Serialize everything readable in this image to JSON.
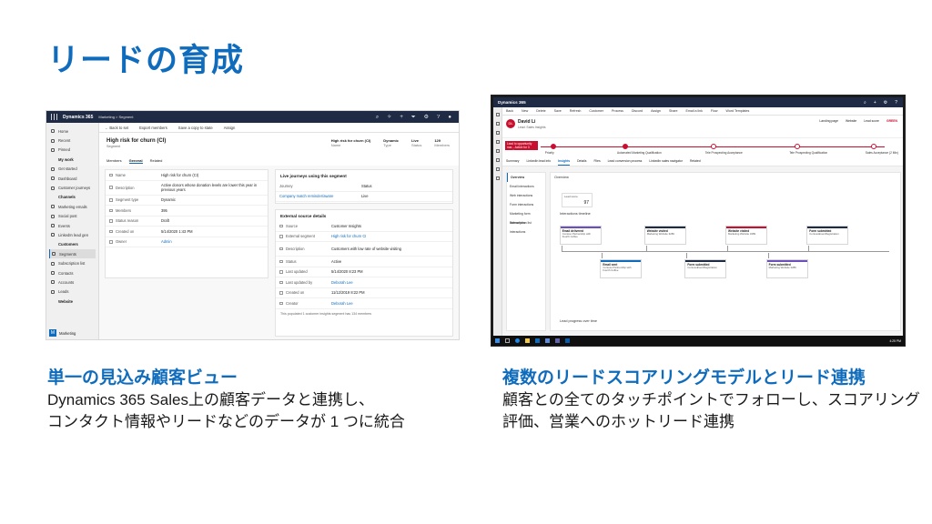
{
  "slide": {
    "title": "リードの育成"
  },
  "left": {
    "app_name": "Dynamics 365",
    "breadcrumb": "Marketing  >  Segment",
    "nav": [
      {
        "label": "Home",
        "group": false
      },
      {
        "label": "Recent",
        "group": false
      },
      {
        "label": "Pinned",
        "group": false
      },
      {
        "label": "My work",
        "group": true
      },
      {
        "label": "Get started",
        "group": false
      },
      {
        "label": "Dashboard",
        "group": false
      },
      {
        "label": "Customer journeys",
        "group": false
      },
      {
        "label": "Channels",
        "group": true
      },
      {
        "label": "Marketing emails",
        "group": false
      },
      {
        "label": "Social post",
        "group": false
      },
      {
        "label": "Events",
        "group": false
      },
      {
        "label": "LinkedIn lead gen",
        "group": false
      },
      {
        "label": "Customers",
        "group": true
      },
      {
        "label": "Segments",
        "group": false,
        "active": true
      },
      {
        "label": "Subscription list",
        "group": false
      },
      {
        "label": "Contacts",
        "group": false
      },
      {
        "label": "Accounts",
        "group": false
      },
      {
        "label": "Leads",
        "group": false
      },
      {
        "label": "Website",
        "group": true
      }
    ],
    "area_badge": "M",
    "area_label": "Marketing",
    "commands": [
      "← Back to set",
      "Export members",
      "Save a copy to state",
      "Assign"
    ],
    "record_title": "High risk for churn (CI)",
    "record_subtitle": "Segment",
    "tabs": [
      "Members",
      "General",
      "Related"
    ],
    "header_meta": [
      {
        "value": "High risk for churn (CI)",
        "label": "Name"
      },
      {
        "value": "Dynamic",
        "label": "Type"
      },
      {
        "value": "Live",
        "label": "Status"
      },
      {
        "value": "129",
        "label": "Members"
      }
    ],
    "general_fields": [
      {
        "label": "Name",
        "value": "High risk for churn (CI)"
      },
      {
        "label": "Description",
        "value": "Active donors whose donation levels are lower this year in previous years"
      },
      {
        "label": "Segment type",
        "value": "Dynamic"
      },
      {
        "label": "Members",
        "value": "395"
      },
      {
        "label": "Status reason",
        "value": "Draft"
      },
      {
        "label": "Created on",
        "value": "5/14/2020 1:43 PM"
      },
      {
        "label": "Owner",
        "value": "Admin"
      }
    ],
    "journeys_title": "Live journeys using this segment",
    "journeys_headers": [
      "Journey",
      "Status"
    ],
    "journeys_row": {
      "name": "Company match reminder/aware",
      "status": "Live"
    },
    "external_title": "External source details",
    "external_fields": [
      {
        "label": "Source",
        "value": "Customer Insights"
      },
      {
        "label": "External segment",
        "value": "High risk for churn CI"
      },
      {
        "label": "Description",
        "value": "Customers with low rate of website visiting"
      },
      {
        "label": "Status",
        "value": "Active"
      },
      {
        "label": "Last updated",
        "value": "5/14/2020 8:23 PM"
      },
      {
        "label": "Last updated by",
        "value": "Deborah Lee"
      },
      {
        "label": "Created on",
        "value": "11/12/2019 8:22 PM"
      },
      {
        "label": "Creator",
        "value": "Deborah Lee"
      }
    ],
    "footnote": "This populated 1 customer insights segment has 134 members"
  },
  "right": {
    "app_name": "Dynamics 365",
    "commands": [
      "Back",
      "New",
      "Delete",
      "Save",
      "Refresh",
      "Customer",
      "Process",
      "Discord",
      "Assign",
      "Share",
      "Email a link",
      "Flow",
      "Word Templates"
    ],
    "contact_initials": "DL",
    "contact_name": "David Li",
    "contact_subtitle": "Lead: Sales Insights",
    "header_meta": [
      "Landing page",
      "Website",
      "Lead score"
    ],
    "score_label": "GREEN",
    "bpf_active_label": "Lead to opportunity mar... Active for 3 months",
    "bpf_stages": [
      "Priority",
      "Automated Marketing Qualification",
      "Tele Prospecting Acceptance",
      "Tele Prospecting Qualification",
      "Sales Acceptance (2 Min)"
    ],
    "tabs": [
      "Summary",
      "LinkedIn lead info",
      "Insights",
      "Details",
      "Files",
      "Lead conversion process",
      "LinkedIn sales navigator",
      "Related"
    ],
    "active_tab": "Insights",
    "side_items": [
      "Overview",
      "Email interactions",
      "Web interactions",
      "Form interactions",
      "Marketing form interactions",
      "Subscription list interactions"
    ],
    "side_active": "Overview",
    "panel_title": "Overview",
    "score_title": "Lead score",
    "score_value": "97",
    "timeline_title": "Interactions timeline",
    "timeline_top": [
      {
        "title": "Email delivered",
        "detail": "Contoso Partnership with Fourth Coffee",
        "color": "#6b4fbb"
      },
      {
        "title": "Website visited",
        "detail": "Marketing Website 3289",
        "color": "#1f2a44"
      },
      {
        "title": "Website visited",
        "detail": "Marketing Website 3289",
        "color": "#c8102e"
      },
      {
        "title": "Form submitted",
        "detail": "ContosoEventRegistration",
        "color": "#1f2a44"
      }
    ],
    "timeline_bottom": [
      {
        "title": "Email sent",
        "detail": "Contoso Partnership with Fourth Coffee",
        "color": "#0f6cbd"
      },
      {
        "title": "Form submitted",
        "detail": "ContosoEventRegistration",
        "color": "#1f2a44"
      },
      {
        "title": "Form submitted",
        "detail": "Marketing Website 3289",
        "color": "#6b4fbb"
      }
    ],
    "progress_title": "Lead progress over time",
    "clock": "4:25 PM"
  },
  "captions": {
    "left_title": "単一の見込み顧客ビュー",
    "left_line1": "Dynamics 365 Sales上の顧客データと連携し、",
    "left_line2": "コンタクト情報やリードなどのデータが 1 つに統合",
    "right_title": "複数のリードスコアリングモデルとリード連携",
    "right_line1": "顧客との全てのタッチポイントでフォローし、スコアリング",
    "right_line2": "評価、営業へのホットリード連携"
  }
}
